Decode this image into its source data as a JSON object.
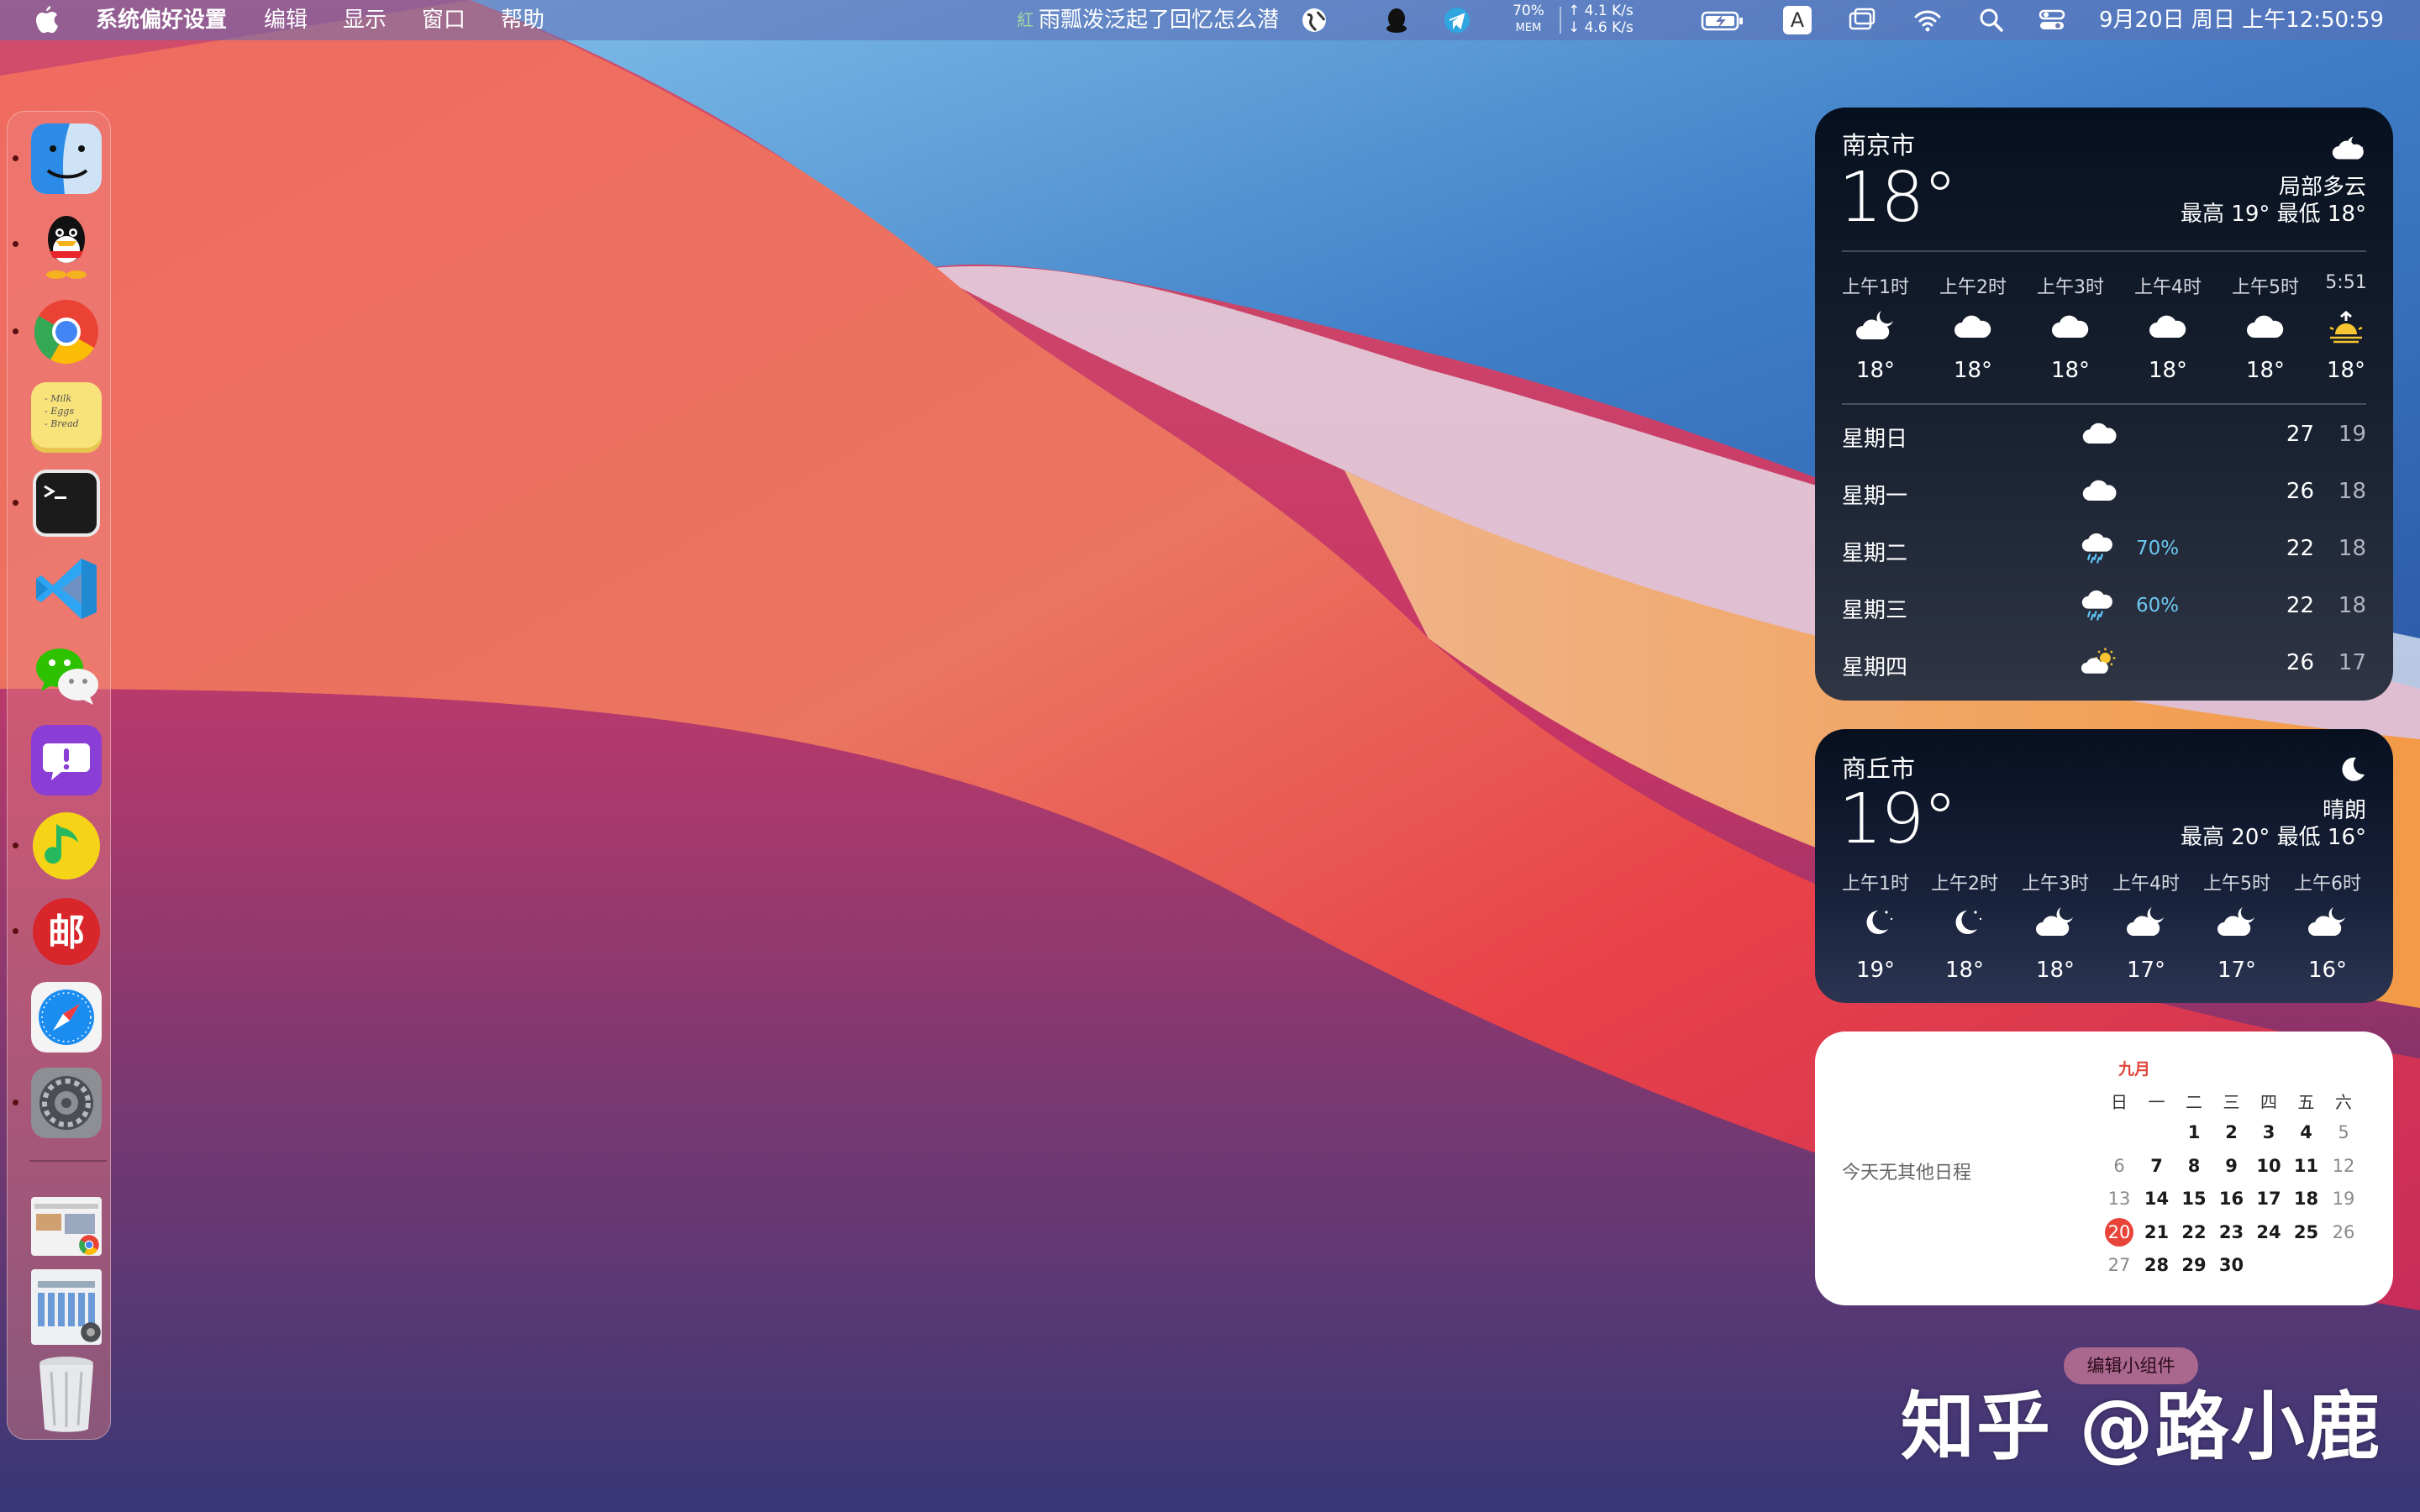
{
  "menubar": {
    "app_name": "系统偏好设置",
    "menus": [
      "编辑",
      "显示",
      "窗口",
      "帮助"
    ],
    "now_playing": "雨瓢泼泛起了回忆怎么潜",
    "now_playing_prefix": "紅",
    "mem_percent": "70%",
    "mem_label": "MEM",
    "net_up": "↑ 4.1 K/s",
    "net_down": "↓ 4.6 K/s",
    "input_method": "A",
    "clock": "9月20日 周日 上午12:50:59"
  },
  "dock": {
    "apps": [
      "finder-icon",
      "qq-icon",
      "chrome-icon",
      "stickies-icon",
      "terminal-icon",
      "vscode-icon",
      "wechat-icon",
      "feedback-icon",
      "music-icon",
      "mail-icon",
      "safari-icon",
      "system-preferences-icon"
    ],
    "stickies_lines": [
      "- Milk",
      "- Eggs",
      "- Bread"
    ],
    "recent_windows": [
      "chrome-window-thumbnail",
      "system-preferences-window-thumbnail"
    ],
    "trash": "trash-icon"
  },
  "weather_nanjing": {
    "city": "南京市",
    "temp": "18°",
    "condition": "局部多云",
    "hilo": "最高 19° 最低 18°",
    "hourly": [
      {
        "label": "上午1时",
        "icon": "cloud-moon",
        "temp": "18°"
      },
      {
        "label": "上午2时",
        "icon": "cloud",
        "temp": "18°"
      },
      {
        "label": "上午3时",
        "icon": "cloud",
        "temp": "18°"
      },
      {
        "label": "上午4时",
        "icon": "cloud",
        "temp": "18°"
      },
      {
        "label": "上午5时",
        "icon": "cloud",
        "temp": "18°"
      },
      {
        "label": "5:51",
        "icon": "sunrise",
        "temp": "18°"
      }
    ],
    "daily": [
      {
        "day": "星期日",
        "icon": "cloud",
        "precip": "",
        "hi": "27",
        "lo": "19"
      },
      {
        "day": "星期一",
        "icon": "cloud",
        "precip": "",
        "hi": "26",
        "lo": "18"
      },
      {
        "day": "星期二",
        "icon": "cloud-rain",
        "precip": "70%",
        "hi": "22",
        "lo": "18"
      },
      {
        "day": "星期三",
        "icon": "cloud-rain",
        "precip": "60%",
        "hi": "22",
        "lo": "18"
      },
      {
        "day": "星期四",
        "icon": "cloud-sun",
        "precip": "",
        "hi": "26",
        "lo": "17"
      }
    ]
  },
  "weather_shangqiu": {
    "city": "商丘市",
    "temp": "19°",
    "condition": "晴朗",
    "hilo": "最高 20° 最低 16°",
    "hourly": [
      {
        "label": "上午1时",
        "icon": "moon-stars",
        "temp": "19°"
      },
      {
        "label": "上午2时",
        "icon": "moon-stars",
        "temp": "18°"
      },
      {
        "label": "上午3时",
        "icon": "cloud-moon",
        "temp": "18°"
      },
      {
        "label": "上午4时",
        "icon": "cloud-moon",
        "temp": "17°"
      },
      {
        "label": "上午5时",
        "icon": "cloud-moon",
        "temp": "17°"
      },
      {
        "label": "上午6时",
        "icon": "cloud-moon",
        "temp": "16°"
      }
    ]
  },
  "calendar": {
    "no_events": "今天无其他日程",
    "month": "九月",
    "weekdays": [
      "日",
      "一",
      "二",
      "三",
      "四",
      "五",
      "六"
    ],
    "weeks": [
      [
        "",
        "",
        "1",
        "2",
        "3",
        "4",
        "5"
      ],
      [
        "6",
        "7",
        "8",
        "9",
        "10",
        "11",
        "12"
      ],
      [
        "13",
        "14",
        "15",
        "16",
        "17",
        "18",
        "19"
      ],
      [
        "20",
        "21",
        "22",
        "23",
        "24",
        "25",
        "26"
      ],
      [
        "27",
        "28",
        "29",
        "30",
        "",
        "",
        ""
      ]
    ],
    "today": "20"
  },
  "edit_widgets_label": "编辑小组件",
  "watermark": "知乎 @路小鹿",
  "colors": {
    "accent": "#e8443a",
    "precip": "#6cc8f2",
    "menubar": "#6e7ab4"
  }
}
